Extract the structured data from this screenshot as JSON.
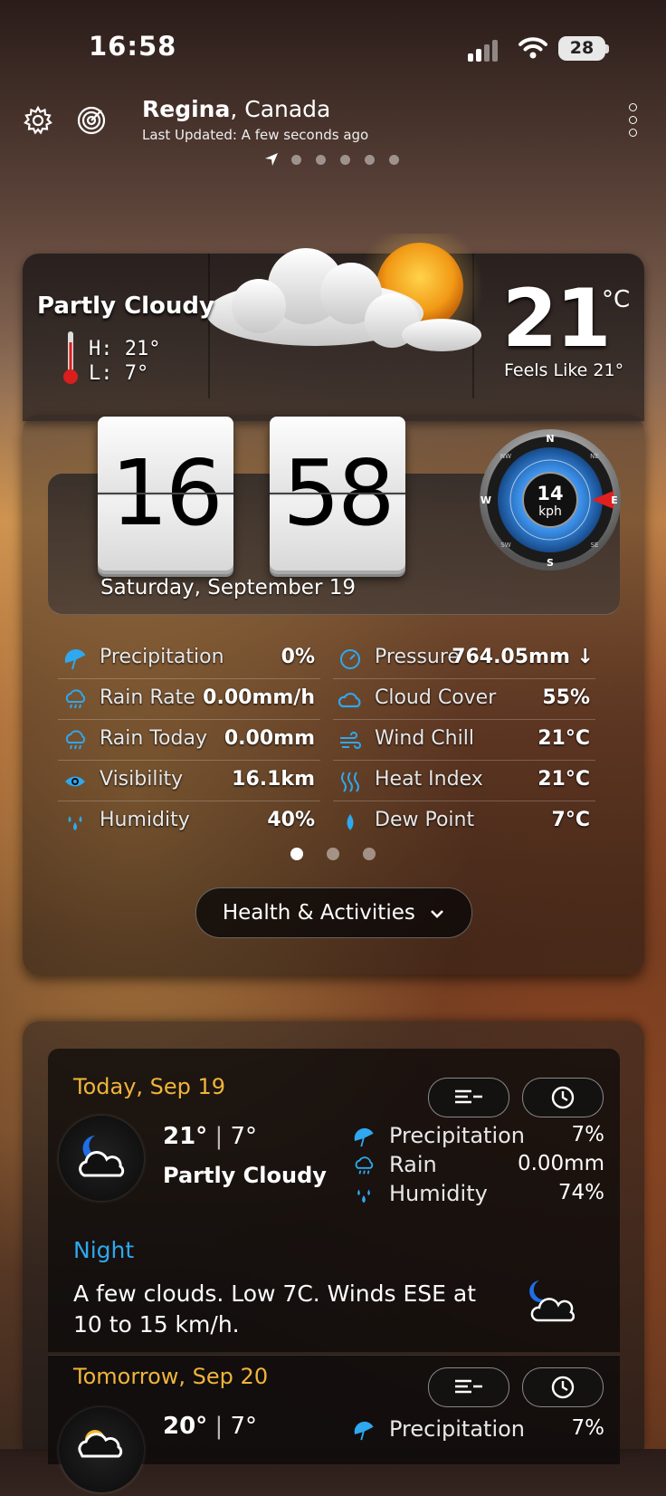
{
  "status": {
    "time": "16:58",
    "battery": "28"
  },
  "header": {
    "city": "Regina",
    "country": ", Canada",
    "updated": "Last Updated: A few seconds ago",
    "page_dot_count": 5
  },
  "current": {
    "condition": "Partly Cloudy",
    "high": "H: 21°",
    "low": "L: 7°",
    "temp": "21",
    "unit": "°C",
    "feels_like": "Feels Like 21°"
  },
  "clock": {
    "hour": "16",
    "minute": "58",
    "date": "Saturday, September 19"
  },
  "wind": {
    "speed": "14",
    "unit": "kph",
    "compass": {
      "n": "N",
      "e": "E",
      "s": "S",
      "w": "W",
      "ne": "NE",
      "nw": "NW",
      "se": "SE",
      "sw": "SW"
    }
  },
  "stats_left": [
    {
      "icon": "umbrella-icon",
      "label": "Precipitation",
      "value": "0%"
    },
    {
      "icon": "rain-cloud-icon",
      "label": "Rain Rate",
      "value": "0.00mm/h"
    },
    {
      "icon": "rain-cloud-icon",
      "label": "Rain Today",
      "value": "0.00mm"
    },
    {
      "icon": "eye-icon",
      "label": "Visibility",
      "value": "16.1km"
    },
    {
      "icon": "humidity-drops-icon",
      "label": "Humidity",
      "value": "40%"
    }
  ],
  "stats_right": [
    {
      "icon": "gauge-icon",
      "label": "Pressure",
      "value": "764.05mm ↓"
    },
    {
      "icon": "cloud-icon",
      "label": "Cloud Cover",
      "value": "55%"
    },
    {
      "icon": "wind-icon",
      "label": "Wind Chill",
      "value": "21°C"
    },
    {
      "icon": "heat-icon",
      "label": "Heat Index",
      "value": "21°C"
    },
    {
      "icon": "drop-icon",
      "label": "Dew Point",
      "value": "7°C"
    }
  ],
  "slides": {
    "count": 3,
    "active": 0
  },
  "health_button": "Health & Activities",
  "forecast": {
    "today": {
      "date": "Today, Sep 19",
      "high": "21°",
      "sep": "|",
      "low": "7°",
      "condition": "Partly Cloudy",
      "stats": [
        {
          "label": "Precipitation",
          "value": "7%"
        },
        {
          "label": "Rain",
          "value": "0.00mm"
        },
        {
          "label": "Humidity",
          "value": "74%"
        }
      ],
      "night_label": "Night",
      "night_text": "A few clouds. Low 7C. Winds ESE at 10 to 15 km/h."
    },
    "tomorrow": {
      "date": "Tomorrow, Sep 20",
      "high": "20°",
      "sep": "|",
      "low": "7°",
      "stats": [
        {
          "label": "Precipitation",
          "value": "7%"
        }
      ]
    }
  },
  "colors": {
    "accent_orange": "#f0b43c",
    "accent_blue": "#2ea8f0",
    "compass_blue": "#3a8ee6",
    "needle_red": "#e02020"
  }
}
